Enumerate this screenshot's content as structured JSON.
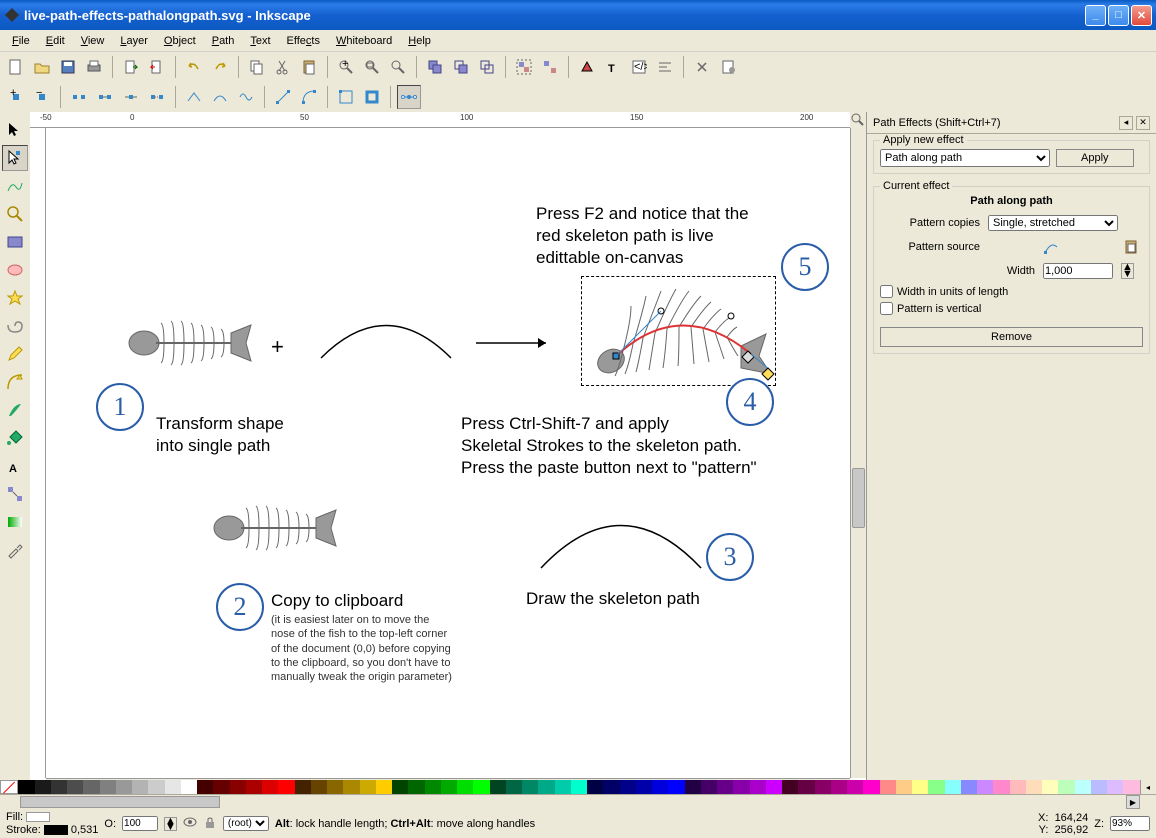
{
  "window": {
    "title": "live-path-effects-pathalongpath.svg - Inkscape"
  },
  "menu": [
    "File",
    "Edit",
    "View",
    "Layer",
    "Object",
    "Path",
    "Text",
    "Effects",
    "Whiteboard",
    "Help"
  ],
  "ruler_labels": [
    "-50",
    "0",
    "50",
    "100",
    "150",
    "200"
  ],
  "canvas": {
    "step1_num": "1",
    "step1_text": "Transform shape\ninto single path",
    "step2_num": "2",
    "step2_title": "Copy to clipboard",
    "step2_note": "(it is easiest later on to move the nose of the fish to the top-left corner of the document (0,0) before copying to the clipboard, so you don't have to manually tweak the origin parameter)",
    "step3_num": "3",
    "step3_text": "Draw the skeleton path",
    "step4_num": "4",
    "step4_text": "Press Ctrl-Shift-7 and apply\nSkeletal Strokes to the skeleton path.\nPress the paste button next to \"pattern\"",
    "step5_num": "5",
    "step5_text": "Press F2 and notice that the\nred skeleton path is live\nedittable on-canvas",
    "plus": "+"
  },
  "panel": {
    "title": "Path Effects (Shift+Ctrl+7)",
    "apply_legend": "Apply new effect",
    "effect_options": [
      "Path along path"
    ],
    "apply_btn": "Apply",
    "current_legend": "Current effect",
    "effect_name": "Path along path",
    "pattern_copies_lbl": "Pattern copies",
    "pattern_copies_val": "Single, stretched",
    "pattern_source_lbl": "Pattern source",
    "width_lbl": "Width",
    "width_val": "1,000",
    "chk1": "Width in units of length",
    "chk2": "Pattern is vertical",
    "remove_btn": "Remove"
  },
  "status": {
    "fill_lbl": "Fill:",
    "stroke_lbl": "Stroke:",
    "stroke_val": "0,531",
    "opacity_lbl": "O:",
    "opacity_val": "100",
    "layer": "(root)",
    "hint": "Alt: lock handle length; Ctrl+Alt: move along handles",
    "x_lbl": "X:",
    "x_val": "164,24",
    "y_lbl": "Y:",
    "y_val": "256,92",
    "z_lbl": "Z:",
    "z_val": "93%"
  }
}
